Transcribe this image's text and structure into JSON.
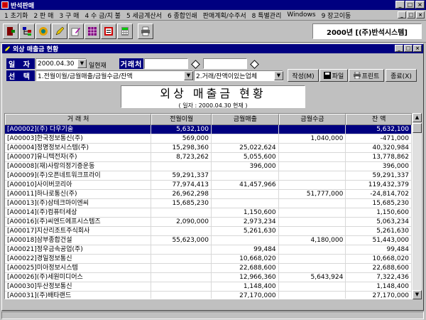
{
  "app": {
    "title": "반석판매",
    "company": "2000년 [(주)반석시스템]"
  },
  "menu": [
    "1 초기화",
    "2 판 매",
    "3 구 매",
    "4 수 금/지 불",
    "5 세금계산서",
    "6 종합인쇄",
    "판매계획/수주서",
    "8 특별관리",
    "Windows",
    "9 장고이동"
  ],
  "toolbar": {
    "icons": [
      "exit-icon",
      "tree-icon",
      "globe-icon",
      "pencil-icon",
      "edit-icon",
      "grid-icon",
      "report-icon",
      "calculator-icon",
      "printer-icon"
    ]
  },
  "child": {
    "title": "외상 매출금 현황"
  },
  "filter": {
    "date_label": "일 자",
    "date_value": "2000.04.30",
    "date_suffix": "일현재",
    "customer_label": "거래처",
    "customer_from": "",
    "customer_to": "",
    "select_label": "선 택",
    "select_value": "1.전월이월/금월매출/금월수금/잔액",
    "option_value": "2.거래/잔액이있는업체"
  },
  "actions": {
    "run": "작성(M)",
    "file": "파일",
    "print": "프린트",
    "close": "종료(X)"
  },
  "report": {
    "title": "외상 매출금 현황",
    "subtitle": "( 일자 : 2000.04.30 현재 )"
  },
  "table": {
    "headers": [
      "거 래 처",
      "전월이월",
      "금월매출",
      "금월수금",
      "잔 액"
    ],
    "rows": [
      [
        "[A00002](주) 다우기술",
        "5,632,100",
        "",
        "",
        "5,632,100"
      ],
      [
        "[A00003]한국정보통신(주)",
        "569,000",
        "",
        "1,040,000",
        "-471,000"
      ],
      [
        "[A00004]정명정보시스템(주)",
        "15,298,360",
        "25,022,624",
        "",
        "40,320,984"
      ],
      [
        "[A00007]유니텍전자(주)",
        "8,723,262",
        "5,055,600",
        "",
        "13,778,862"
      ],
      [
        "[A00008](재)사랑의정기증운동",
        "",
        "396,000",
        "",
        "396,000"
      ],
      [
        "[A00009](주)오픈네트워크프라이",
        "59,291,337",
        "",
        "",
        "59,291,337"
      ],
      [
        "[A00010]사이버코리아",
        "77,974,413",
        "41,457,966",
        "",
        "119,432,379"
      ],
      [
        "[A00011]하나로통신(주)",
        "26,962,298",
        "",
        "51,777,000",
        "-24,814,702"
      ],
      [
        "[A00013](주)삼테크마이엔씨",
        "15,685,230",
        "",
        "",
        "15,685,230"
      ],
      [
        "[A00014](주)컴퓨터세상",
        "",
        "1,150,600",
        "",
        "1,150,600"
      ],
      [
        "[A00016](주)씨엔드에프시스템즈",
        "2,090,000",
        "2,973,234",
        "",
        "5,063,234"
      ],
      [
        "[A00017]지산리조트주식회사",
        "",
        "5,261,630",
        "",
        "5,261,630"
      ],
      [
        "[A00018]삼부종합건설",
        "55,623,000",
        "",
        "4,180,000",
        "51,443,000"
      ],
      [
        "[A00021]정우금속공업(주)",
        "",
        "99,484",
        "",
        "99,484"
      ],
      [
        "[A00022]경일정보통신",
        "",
        "10,668,020",
        "",
        "10,668,020"
      ],
      [
        "[A00025]미아정보시스템",
        "",
        "22,688,600",
        "",
        "22,688,600"
      ],
      [
        "[A00026](주)세원미디어스",
        "",
        "12,966,360",
        "5,643,924",
        "7,322,436"
      ],
      [
        "[A00030]두산정보통신",
        "",
        "1,148,400",
        "",
        "1,148,400"
      ],
      [
        "[A00031](주)배타랜드",
        "",
        "27,170,000",
        "",
        "27,170,000"
      ]
    ]
  }
}
